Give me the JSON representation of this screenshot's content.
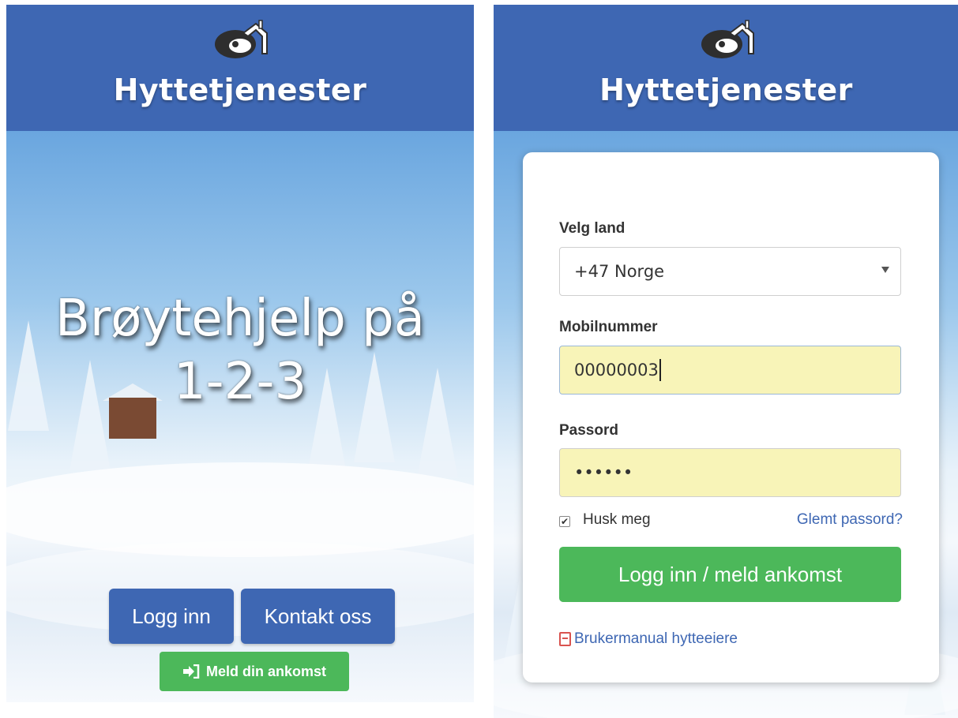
{
  "colors": {
    "brand_blue": "#3e67b3",
    "green": "#4cb85a",
    "autofill_yellow": "#f8f4b8",
    "link": "#3e67b3"
  },
  "left_screen": {
    "brand": "Hyttetjenester",
    "headline_line1": "Brøytehjelp på",
    "headline_line2": "1-2-3",
    "login_button": "Logg inn",
    "contact_button": "Kontakt oss",
    "arrival_button": "Meld din ankomst",
    "arrival_icon": "sign-in-icon"
  },
  "right_screen": {
    "brand": "Hyttetjenester",
    "country_label": "Velg land",
    "country_value": "+47 Norge",
    "mobile_label": "Mobilnummer",
    "mobile_value": "00000003",
    "password_label": "Passord",
    "password_value": "••••••",
    "remember_label": "Husk meg",
    "remember_checked": true,
    "forgot_link": "Glemt passord?",
    "submit_button": "Logg inn / meld ankomst",
    "manual_link": "Brukermanual hytteeiere",
    "manual_icon": "pdf-icon"
  }
}
